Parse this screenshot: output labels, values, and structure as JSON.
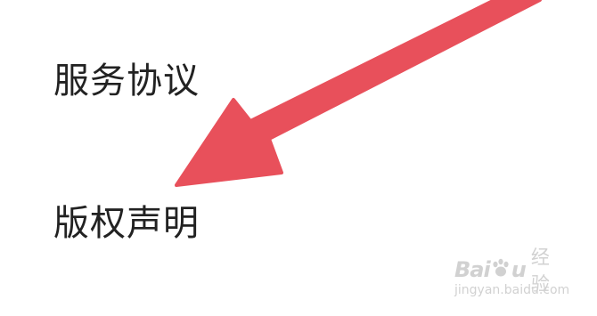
{
  "menu": {
    "items": [
      {
        "label": "服务协议"
      },
      {
        "label": "版权声明"
      }
    ]
  },
  "annotation": {
    "arrow_color": "#e8505b"
  },
  "watermark": {
    "brand": "Bai",
    "brand_suffix": "u",
    "cn_text": "经验",
    "domain": "jingyan.baidu.com"
  }
}
